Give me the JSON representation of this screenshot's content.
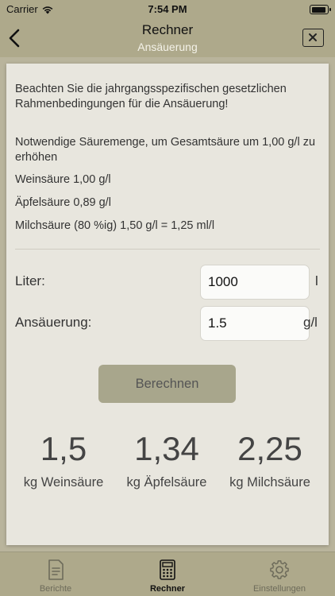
{
  "status": {
    "carrier": "Carrier",
    "time": "7:54 PM"
  },
  "nav": {
    "title": "Rechner",
    "subtitle": "Ansäuerung"
  },
  "info": {
    "notice": "Beachten Sie die jahrgangsspezifischen gesetzlichen Rahmenbedingungen für die Ansäuerung!",
    "required": "Notwendige Säuremenge, um Gesamtsäure um 1,00 g/l zu erhöhen",
    "tartaric": "Weinsäure 1,00 g/l",
    "malic": "Äpfelsäure 0,89 g/l",
    "lactic": "Milchsäure (80 %ig) 1,50 g/l = 1,25 ml/l"
  },
  "form": {
    "liters_label": "Liter:",
    "liters_value": "1000",
    "liters_unit": "l",
    "acid_label": "Ansäuerung:",
    "acid_value": "1.5",
    "acid_unit": "g/l",
    "calc_button": "Berechnen"
  },
  "results": [
    {
      "value": "1,5",
      "label": "kg Weinsäure"
    },
    {
      "value": "1,34",
      "label": "kg Äpfelsäure"
    },
    {
      "value": "2,25",
      "label": "kg Milchsäure"
    }
  ],
  "tabs": [
    {
      "label": "Berichte",
      "icon": "document-icon",
      "active": false
    },
    {
      "label": "Rechner",
      "icon": "calculator-icon",
      "active": true
    },
    {
      "label": "Einstellungen",
      "icon": "gear-icon",
      "active": false
    }
  ]
}
